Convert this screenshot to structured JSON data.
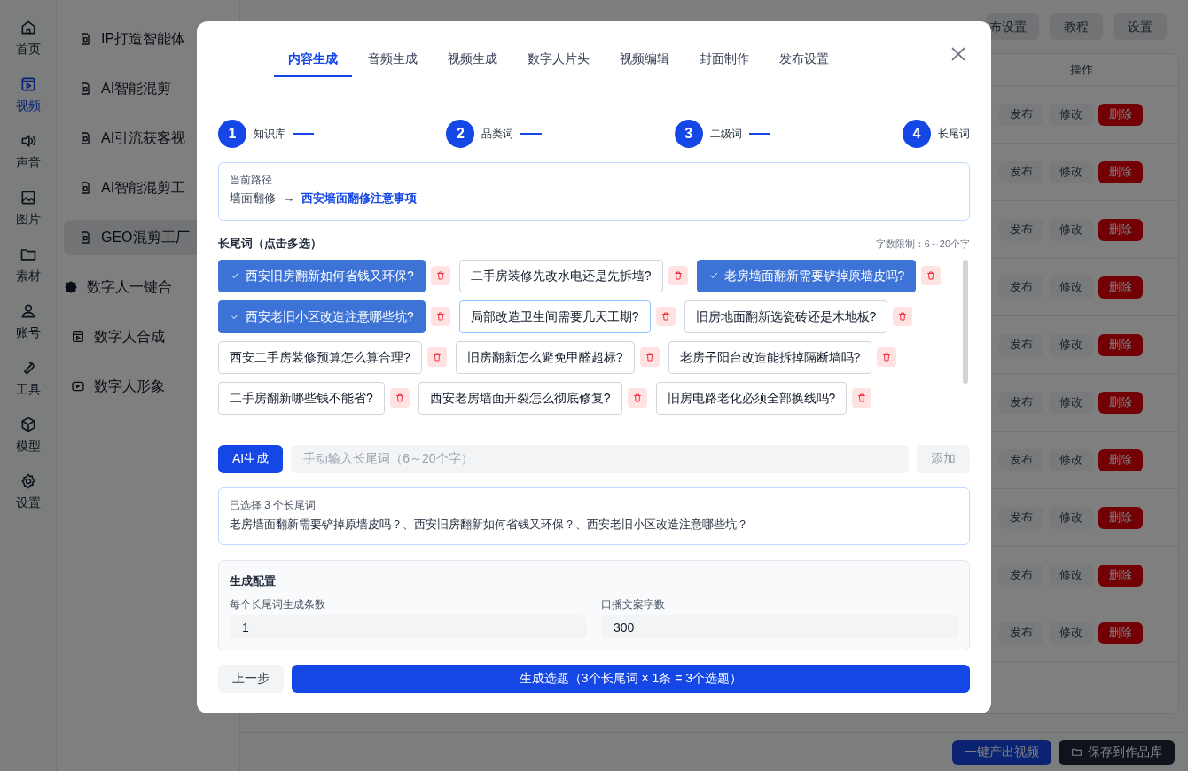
{
  "nav_rail": [
    {
      "label": "首页",
      "selected": false
    },
    {
      "label": "视频",
      "selected": true
    },
    {
      "label": "声音",
      "selected": false
    },
    {
      "label": "图片",
      "selected": false
    },
    {
      "label": "素材",
      "selected": false
    },
    {
      "label": "账号",
      "selected": false
    },
    {
      "label": "工具",
      "selected": false
    },
    {
      "label": "模型",
      "selected": false
    },
    {
      "label": "设置",
      "selected": false
    }
  ],
  "sidebar": {
    "items": [
      {
        "label": "IP打造智能体",
        "kind": "doc",
        "selected": false
      },
      {
        "label": "AI智能混剪",
        "kind": "doc",
        "selected": false
      },
      {
        "label": "AI引流获客视",
        "kind": "doc",
        "selected": false
      },
      {
        "label": "AI智能混剪工",
        "kind": "doc",
        "selected": false
      },
      {
        "label": "GEO混剪工厂",
        "kind": "doc",
        "selected": true
      },
      {
        "label": "数字人一键合",
        "kind": "badge",
        "selected": false
      },
      {
        "label": "数字人合成",
        "kind": "sub-video",
        "selected": false
      },
      {
        "label": "数字人形象",
        "kind": "sub-avatar",
        "selected": false
      }
    ]
  },
  "header_buttons": [
    "布设置",
    "教程",
    "设置"
  ],
  "table": {
    "action_column": "操作",
    "rows": [
      {
        "actions": [
          "发布",
          "修改",
          "删除"
        ]
      },
      {
        "actions": [
          "发布",
          "修改",
          "删除"
        ]
      },
      {
        "actions": [
          "发布",
          "修改",
          "删除"
        ]
      },
      {
        "actions": [
          "发布",
          "修改",
          "删除"
        ]
      },
      {
        "actions": [
          "发布",
          "修改",
          "删除"
        ]
      },
      {
        "actions": [
          "发布",
          "修改",
          "删除"
        ]
      },
      {
        "actions": [
          "发布",
          "修改",
          "删除"
        ]
      },
      {
        "actions": [
          "发布",
          "修改",
          "删除"
        ]
      },
      {
        "actions": [
          "发布",
          "修改",
          "删除"
        ]
      },
      {
        "actions": [
          "发布",
          "修改",
          "删除"
        ]
      }
    ]
  },
  "footer_buttons": [
    {
      "label": "一键产出视频",
      "kind": "primary"
    },
    {
      "label": "保存到作品库",
      "kind": "dark"
    }
  ],
  "modal": {
    "tabs": [
      {
        "label": "内容生成",
        "selected": true
      },
      {
        "label": "音频生成",
        "selected": false
      },
      {
        "label": "视频生成",
        "selected": false
      },
      {
        "label": "数字人片头",
        "selected": false
      },
      {
        "label": "视频编辑",
        "selected": false
      },
      {
        "label": "封面制作",
        "selected": false
      },
      {
        "label": "发布设置",
        "selected": false
      }
    ],
    "steps": [
      {
        "number": "1",
        "label": "知识库"
      },
      {
        "number": "2",
        "label": "品类词"
      },
      {
        "number": "3",
        "label": "二级词"
      },
      {
        "number": "4",
        "label": "长尾词"
      }
    ],
    "path": {
      "label": "当前路径",
      "parent": "墙面翻修",
      "arrow": "→",
      "current": "西安墙面翻修注意事项"
    },
    "keywords_title": "长尾词（点击多选）",
    "limit_note": "字数限制：6～20个字",
    "keywords": [
      {
        "text": "西安旧房翻新如何省钱又环保?",
        "selected": true,
        "hovered": false
      },
      {
        "text": "二手房装修先改水电还是先拆墙?",
        "selected": false,
        "hovered": false
      },
      {
        "text": "老房墙面翻新需要铲掉原墙皮吗?",
        "selected": true,
        "hovered": false
      },
      {
        "text": "西安老旧小区改造注意哪些坑?",
        "selected": true,
        "hovered": false
      },
      {
        "text": "局部改造卫生间需要几天工期?",
        "selected": false,
        "hovered": true
      },
      {
        "text": "旧房地面翻新选瓷砖还是木地板?",
        "selected": false,
        "hovered": false
      },
      {
        "text": "西安二手房装修预算怎么算合理?",
        "selected": false,
        "hovered": false
      },
      {
        "text": "旧房翻新怎么避免甲醛超标?",
        "selected": false,
        "hovered": false
      },
      {
        "text": "老房子阳台改造能拆掉隔断墙吗?",
        "selected": false,
        "hovered": false
      },
      {
        "text": "二手房翻新哪些钱不能省?",
        "selected": false,
        "hovered": false
      },
      {
        "text": "西安老房墙面开裂怎么彻底修复?",
        "selected": false,
        "hovered": false
      },
      {
        "text": "旧房电路老化必须全部换线吗?",
        "selected": false,
        "hovered": false
      }
    ],
    "ai_button": "AI生成",
    "manual_input": {
      "placeholder": "手动输入长尾词（6～20个字）"
    },
    "add_button": {
      "label": "添加",
      "disabled": true
    },
    "selected_summary": {
      "label": "已选择 3 个长尾词",
      "text": "老房墙面翻新需要铲掉原墙皮吗？、西安旧房翻新如何省钱又环保？、西安老旧小区改造注意哪些坑？"
    },
    "config": {
      "title": "生成配置",
      "fields": [
        {
          "label": "每个长尾词生成条数",
          "value": "1"
        },
        {
          "label": "口播文案字数",
          "value": "300"
        }
      ]
    },
    "back_button": "上一步",
    "generate_button": "生成选题（3个长尾词 × 1条 = 3个选题）"
  }
}
